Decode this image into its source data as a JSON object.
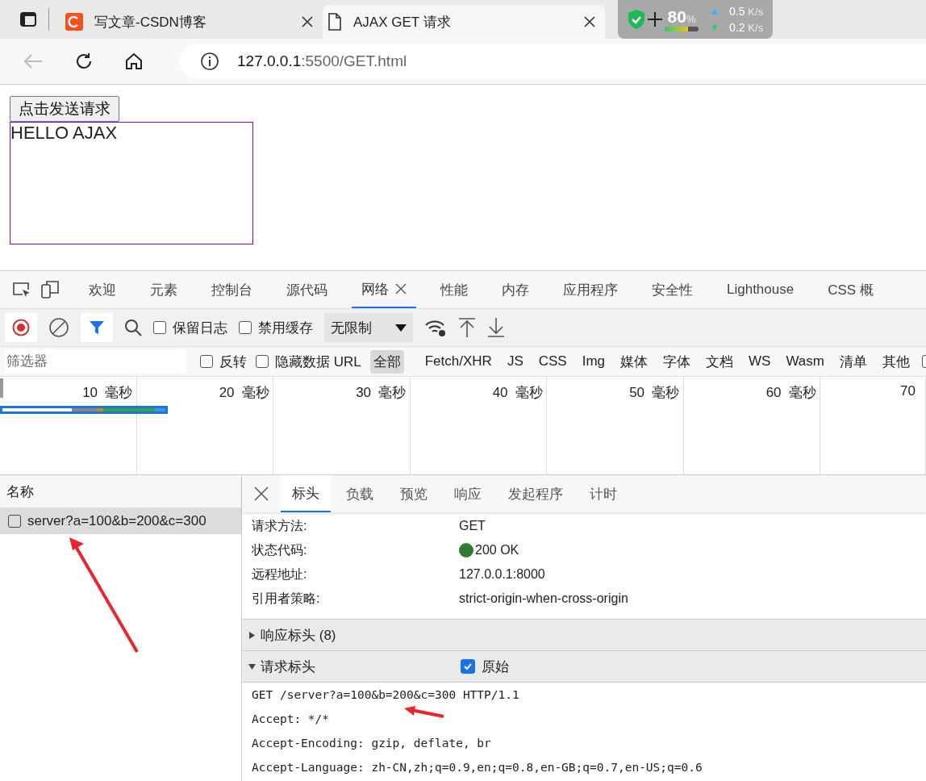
{
  "browser_tabs": [
    {
      "title": "写文章-CSDN博客",
      "kind": "csdn",
      "selected": false
    },
    {
      "title": "AJAX GET 请求",
      "kind": "page",
      "selected": true
    }
  ],
  "speed_widget": {
    "battery": "80",
    "battery_unit": "%",
    "up": "0.5",
    "up_unit": "K/s",
    "down": "0.2",
    "down_unit": "K/s"
  },
  "address_bar": {
    "host": "127.0.0.1",
    "path": ":5500/GET.html"
  },
  "page": {
    "button": "点击发送请求",
    "result": "HELLO AJAX"
  },
  "devtools_tabs": [
    {
      "label": "欢迎",
      "selected": false,
      "closable": false
    },
    {
      "label": "元素",
      "selected": false,
      "closable": false
    },
    {
      "label": "控制台",
      "selected": false,
      "closable": false
    },
    {
      "label": "源代码",
      "selected": false,
      "closable": false
    },
    {
      "label": "网络",
      "selected": true,
      "closable": true
    },
    {
      "label": "性能",
      "selected": false,
      "closable": false
    },
    {
      "label": "内存",
      "selected": false,
      "closable": false
    },
    {
      "label": "应用程序",
      "selected": false,
      "closable": false
    },
    {
      "label": "安全性",
      "selected": false,
      "closable": false
    },
    {
      "label": "Lighthouse",
      "selected": false,
      "closable": false
    },
    {
      "label": "CSS 概",
      "selected": false,
      "closable": false
    }
  ],
  "toolbar": {
    "checkboxes": [
      {
        "label": "保留日志",
        "checked": false
      },
      {
        "label": "禁用缓存",
        "checked": false
      }
    ],
    "throttle": "无限制"
  },
  "filter_bar": {
    "placeholder": "筛选器",
    "checkboxes": [
      {
        "label": "反转",
        "checked": false
      },
      {
        "label": "隐藏数据 URL",
        "checked": false
      }
    ],
    "types": [
      {
        "label": "全部",
        "selected": true
      },
      {
        "label": "Fetch/XHR",
        "selected": false
      },
      {
        "label": "JS",
        "selected": false
      },
      {
        "label": "CSS",
        "selected": false
      },
      {
        "label": "Img",
        "selected": false
      },
      {
        "label": "媒体",
        "selected": false
      },
      {
        "label": "字体",
        "selected": false
      },
      {
        "label": "文档",
        "selected": false
      },
      {
        "label": "WS",
        "selected": false
      },
      {
        "label": "Wasm",
        "selected": false
      },
      {
        "label": "清单",
        "selected": false
      },
      {
        "label": "其他",
        "selected": false
      }
    ],
    "last_checkbox": {
      "checked": false
    }
  },
  "timeline": {
    "ticks": [
      "10  毫秒",
      "20  毫秒",
      "30  毫秒",
      "40  毫秒",
      "50  毫秒",
      "60  毫秒",
      "70"
    ]
  },
  "request_list": {
    "header": "名称",
    "rows": [
      {
        "name": "server?a=100&b=200&c=300",
        "selected": true
      }
    ]
  },
  "detail_tabs": [
    {
      "label": "标头",
      "selected": true
    },
    {
      "label": "负载",
      "selected": false
    },
    {
      "label": "预览",
      "selected": false
    },
    {
      "label": "响应",
      "selected": false
    },
    {
      "label": "发起程序",
      "selected": false
    },
    {
      "label": "计时",
      "selected": false
    }
  ],
  "general": [
    {
      "label": "请求方法:",
      "value": "GET"
    },
    {
      "label": "状态代码:",
      "value": "200 OK",
      "color": "#2e7d32"
    },
    {
      "label": "远程地址:",
      "value": "127.0.0.1:8000"
    },
    {
      "label": "引用者策略:",
      "value": "strict-origin-when-cross-origin"
    }
  ],
  "sections": [
    {
      "title": "响应标头 (8)",
      "expanded": false
    },
    {
      "title": "请求标头",
      "expanded": true,
      "raw_label": "原始",
      "raw_checked": true,
      "lines": [
        "GET /server?a=100&b=200&c=300 HTTP/1.1",
        "Accept: */*",
        "Accept-Encoding: gzip, deflate, br",
        "Accept-Language: zh-CN,zh;q=0.9,en;q=0.8,en-GB;q=0.7,en-US;q=0.6"
      ]
    }
  ]
}
